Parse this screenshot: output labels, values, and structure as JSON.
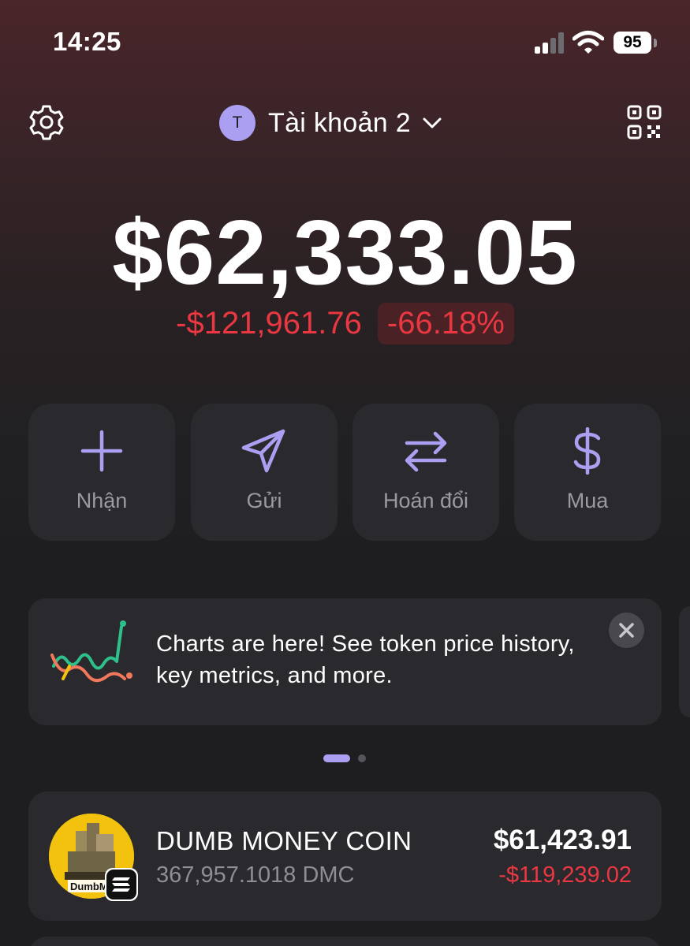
{
  "status_bar": {
    "time": "14:25",
    "battery": "95",
    "icons": [
      "signal-icon",
      "wifi-icon",
      "battery-icon"
    ]
  },
  "header": {
    "settings_icon": "gear-icon",
    "account_initial": "T",
    "account_name": "Tài khoản 2",
    "account_dropdown_icon": "chevron-down-icon",
    "qr_icon": "qr-code-icon"
  },
  "balance": {
    "total": "$62,333.05",
    "change_amount": "-$121,961.76",
    "change_percent": "-66.18%"
  },
  "actions": [
    {
      "label": "Nhận",
      "icon": "plus-icon"
    },
    {
      "label": "Gửi",
      "icon": "send-icon"
    },
    {
      "label": "Hoán đổi",
      "icon": "swap-icon"
    },
    {
      "label": "Mua",
      "icon": "dollar-icon"
    }
  ],
  "promo": {
    "text": "Charts are here! See token price history, key metrics, and more.",
    "icon": "chart-line-icon",
    "close_icon": "close-icon",
    "carousel_page": 1,
    "carousel_pages": 2
  },
  "tokens": [
    {
      "name": "DUMB MONEY COIN",
      "amount": "367,957.1018 DMC",
      "value": "$61,423.91",
      "change": "-$119,239.02",
      "logo_text": "DumbMo",
      "chain_icon": "solana-icon"
    }
  ],
  "colors": {
    "accent": "#ab9ff2",
    "negative": "#eb3742",
    "card": "#2a2a2e",
    "background": "#1e1e20"
  }
}
